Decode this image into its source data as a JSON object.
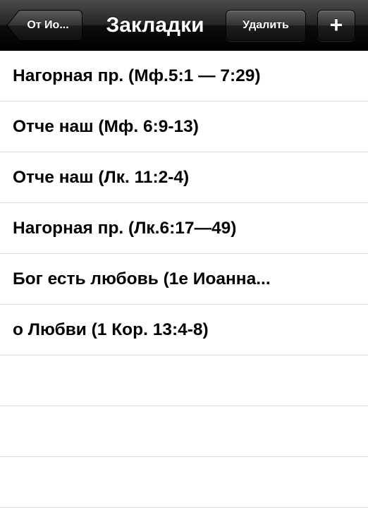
{
  "navbar": {
    "back_label": "От Ио...",
    "title": "Закладки",
    "delete_label": "Удалить",
    "add_label": "+"
  },
  "bookmarks": [
    {
      "label": "Нагорная пр. (Мф.5:1 — 7:29)"
    },
    {
      "label": "Отче наш (Мф. 6:9-13)"
    },
    {
      "label": "Отче наш (Лк. 11:2-4)"
    },
    {
      "label": "Нагорная пр. (Лк.6:17—49)"
    },
    {
      "label": "Бог есть любовь (1е Иоанна..."
    },
    {
      "label": "о Любви (1 Кор. 13:4-8)"
    }
  ]
}
